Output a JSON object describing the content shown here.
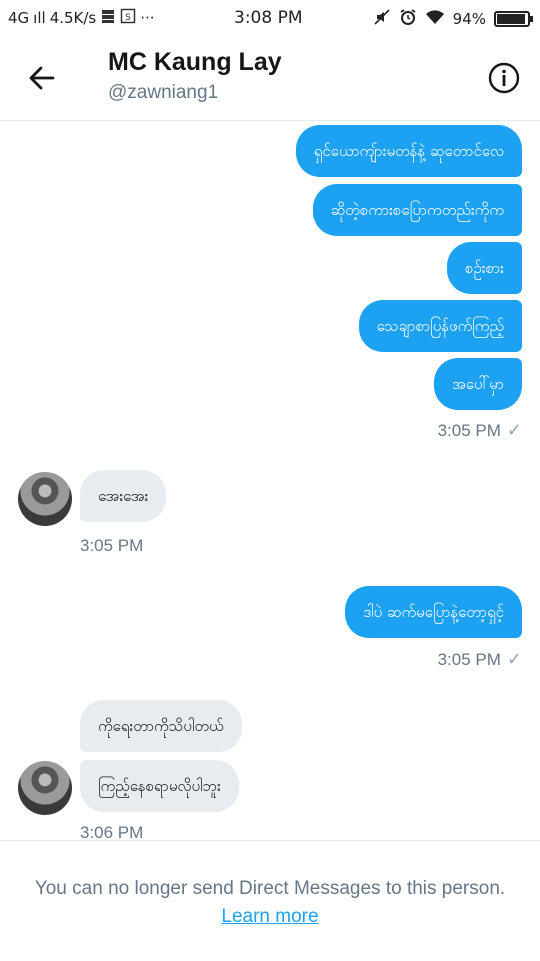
{
  "status_bar": {
    "network": "4G",
    "signal": "ıll",
    "speed": "4.5K/s",
    "more": "···",
    "time": "3:08 PM",
    "battery": "94%",
    "battery_level": 0.94
  },
  "header": {
    "title": "MC Kaung Lay",
    "handle": "@zawniang1"
  },
  "messages": {
    "out1": [
      "ရှင်ယောကျ်ားမတန်နဲ့ ဆုတောင်လေ",
      "ဆိုတဲ့စကားစပြောကတည်းကိုက",
      "စဉ်းစား",
      "သေချာစာပြန်ဖက်ကြည့်",
      "အပေါ်မှာ"
    ],
    "out1_time": "3:05 PM",
    "in1": "အေးအေး",
    "in1_time": "3:05 PM",
    "out2": "ဒါပဲ ဆက်မပြောနဲ့တော့ရှင့်",
    "out2_time": "3:05 PM",
    "in2": [
      "ကိုရေးတာကိုသိပါတယ်",
      "ကြည့်နေစရာမလိုပါဘူး"
    ],
    "in2_time": "3:06 PM"
  },
  "footer": {
    "text": "You can no longer send Direct Messages to this person.",
    "link": "Learn more"
  },
  "colors": {
    "accent": "#1da1f2",
    "bubble_in": "#e6ecf0",
    "muted": "#657786"
  }
}
